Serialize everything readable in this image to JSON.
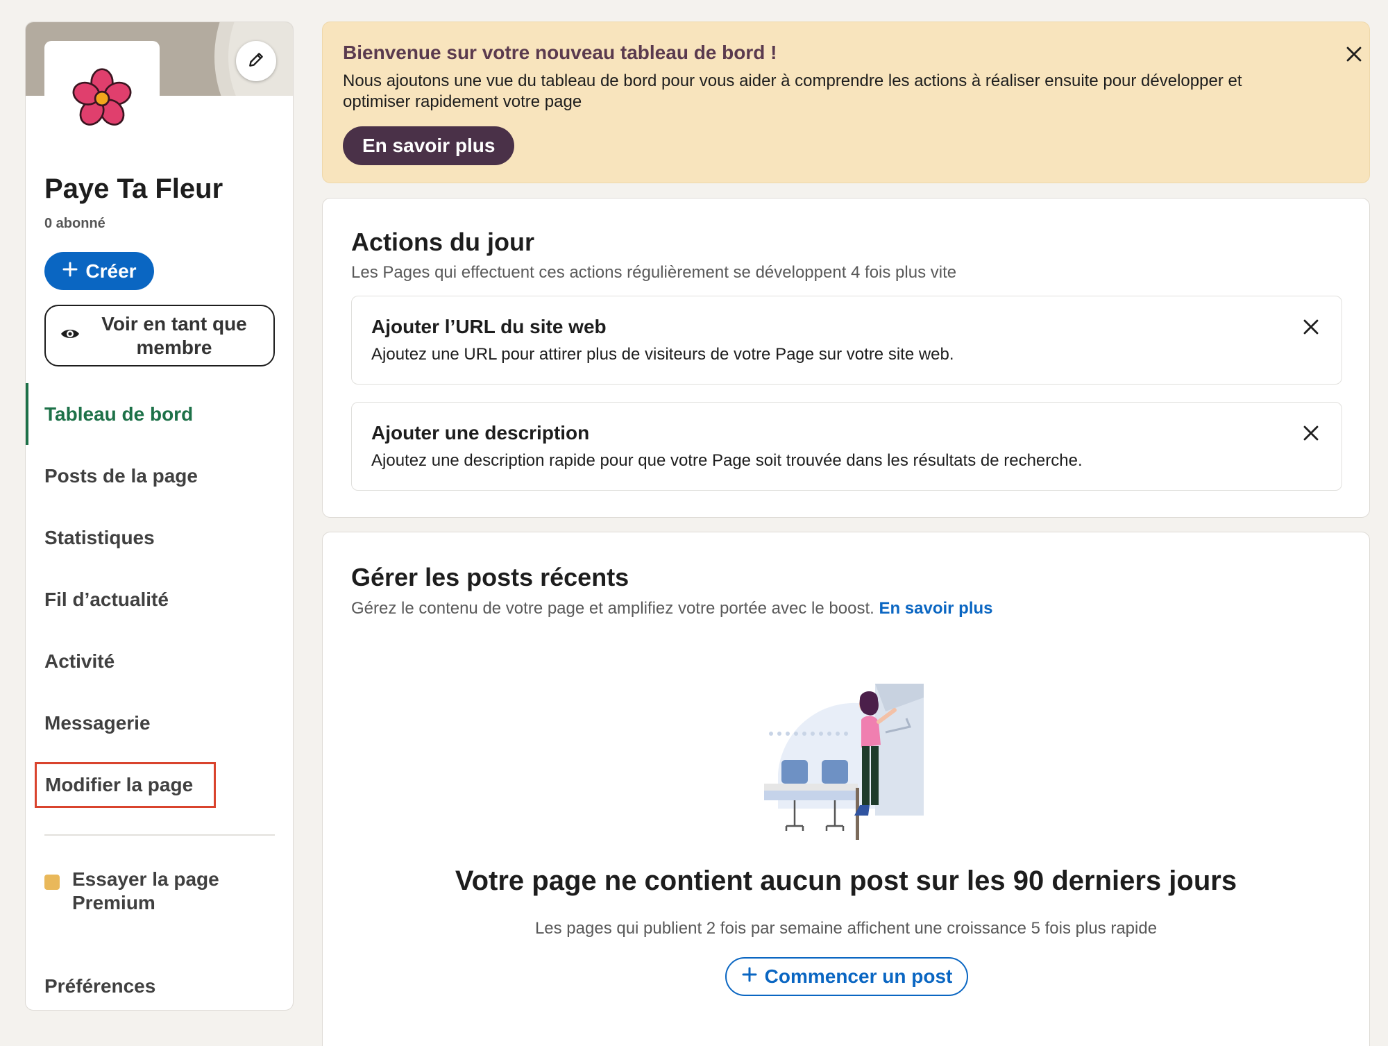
{
  "sidebar": {
    "page_name": "Paye Ta Fleur",
    "followers": "0 abonné",
    "create_label": "Créer",
    "view_as_member_label": "Voir en tant que membre",
    "nav": [
      {
        "label": "Tableau de bord",
        "active": true
      },
      {
        "label": "Posts de la page"
      },
      {
        "label": "Statistiques"
      },
      {
        "label": "Fil d’actualité"
      },
      {
        "label": "Activité"
      },
      {
        "label": "Messagerie"
      },
      {
        "label": "Modifier la page",
        "highlighted": true
      }
    ],
    "premium_label": "Essayer la page Premium",
    "preferences_label": "Préférences"
  },
  "banner": {
    "title": "Bienvenue sur votre nouveau tableau de bord !",
    "text": "Nous ajoutons une vue du tableau de bord pour vous aider à comprendre les actions à réaliser ensuite pour développer et optimiser rapidement votre page",
    "button_label": "En savoir plus"
  },
  "actions": {
    "title": "Actions du jour",
    "subtitle": "Les Pages qui effectuent ces actions régulièrement se développent 4 fois plus vite",
    "tasks": [
      {
        "title": "Ajouter l’URL du site web",
        "text": "Ajoutez une URL pour attirer plus de visiteurs de votre Page sur votre site web."
      },
      {
        "title": "Ajouter une description",
        "text": "Ajoutez une description rapide pour que votre Page soit trouvée dans les résultats de recherche."
      }
    ]
  },
  "posts": {
    "title": "Gérer les posts récents",
    "subtitle": "Gérez le contenu de votre page et amplifiez votre portée avec le boost.",
    "subtitle_link": "En savoir plus",
    "empty_title": "Votre page ne contient aucun post sur les 90 derniers jours",
    "empty_sub": "Les pages qui publient 2 fois par semaine affichent une croissance 5 fois plus rapide",
    "start_post_label": "Commencer un post"
  },
  "colors": {
    "brand_blue": "#0a66c2",
    "active_green": "#1d7148",
    "banner_bg": "#f8e4bd",
    "highlight_red": "#d9432d"
  },
  "icons": [
    "pencil-icon",
    "flower-logo",
    "plus-icon",
    "eye-icon",
    "close-icon",
    "premium-icon",
    "empty-state-illustration"
  ]
}
